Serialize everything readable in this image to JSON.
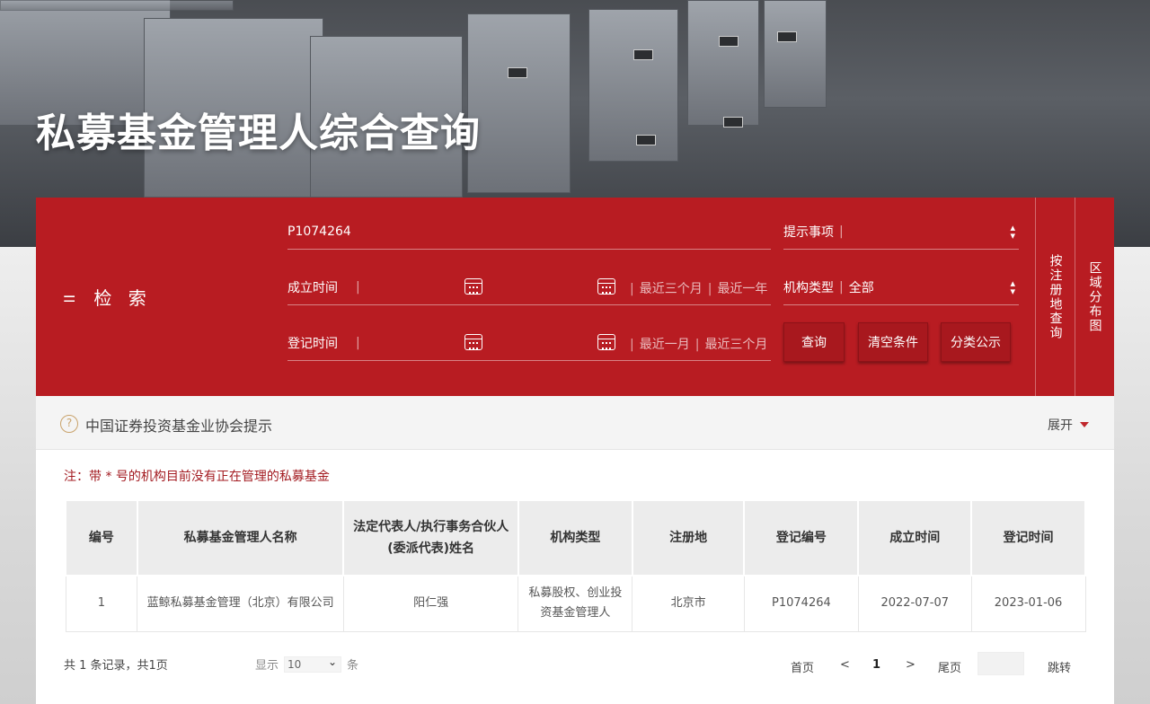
{
  "page": {
    "title": "私募基金管理人综合查询"
  },
  "search": {
    "label": "检 索",
    "registration_no": "P1074264",
    "established": {
      "label": "成立时间",
      "quick1": "最近三个月",
      "quick2": "最近一年"
    },
    "registered": {
      "label": "登记时间",
      "quick1": "最近一月",
      "quick2": "最近三个月"
    },
    "notice_select": {
      "label": "提示事项",
      "value": ""
    },
    "org_type_select": {
      "label": "机构类型",
      "value": "全部"
    },
    "buttons": {
      "query": "查询",
      "clear": "清空条件",
      "classify": "分类公示"
    },
    "side_tabs": {
      "by_region": "按注册地查询",
      "region_map": "区域分布图"
    }
  },
  "notice": {
    "text": "中国证券投资基金业协会提示",
    "expand": "展开",
    "help_icon": "?"
  },
  "note": "注：带 * 号的机构目前没有正在管理的私募基金",
  "table": {
    "headers": [
      "编号",
      "私募基金管理人名称",
      "法定代表人/执行事务合伙人(委派代表)姓名",
      "机构类型",
      "注册地",
      "登记编号",
      "成立时间",
      "登记时间"
    ],
    "rows": [
      [
        "1",
        "蓝鲸私募基金管理（北京）有限公司",
        "阳仁强",
        "私募股权、创业投资基金管理人",
        "北京市",
        "P1074264",
        "2022-07-07",
        "2023-01-06"
      ]
    ]
  },
  "footer": {
    "summary": "共 1 条记录，共1页",
    "show_label": "显示",
    "page_size": "10",
    "unit": "条",
    "first": "首页",
    "prev": "<",
    "current": "1",
    "next": ">",
    "last": "尾页",
    "jump": "跳转"
  },
  "colors": {
    "panel_red": "#b81c22",
    "note_red": "#a31b21",
    "accent_gold": "#c9a36b"
  }
}
